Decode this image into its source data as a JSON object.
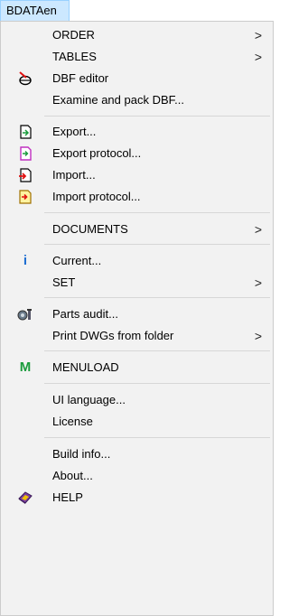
{
  "menubar": {
    "title": "BDATAen"
  },
  "menu": {
    "items": [
      {
        "label": "ORDER",
        "submenu": true,
        "icon": null
      },
      {
        "label": "TABLES",
        "submenu": true,
        "icon": null
      },
      {
        "label": "DBF editor",
        "submenu": false,
        "icon": "dbf-editor-icon"
      },
      {
        "label": "Examine and pack DBF...",
        "submenu": false,
        "icon": null
      },
      {
        "label": "Export...",
        "submenu": false,
        "icon": "export-icon"
      },
      {
        "label": "Export protocol...",
        "submenu": false,
        "icon": "export-protocol-icon"
      },
      {
        "label": "Import...",
        "submenu": false,
        "icon": "import-icon"
      },
      {
        "label": "Import protocol...",
        "submenu": false,
        "icon": "import-protocol-icon"
      },
      {
        "label": "DOCUMENTS",
        "submenu": true,
        "icon": null
      },
      {
        "label": "Current...",
        "submenu": false,
        "icon": "info-icon"
      },
      {
        "label": "SET",
        "submenu": true,
        "icon": null
      },
      {
        "label": "Parts audit...",
        "submenu": false,
        "icon": "parts-audit-icon"
      },
      {
        "label": "Print DWGs from folder",
        "submenu": true,
        "icon": null
      },
      {
        "label": "MENULOAD",
        "submenu": false,
        "icon": "menuload-icon"
      },
      {
        "label": "UI language...",
        "submenu": false,
        "icon": null
      },
      {
        "label": "License",
        "submenu": false,
        "icon": null
      },
      {
        "label": "Build info...",
        "submenu": false,
        "icon": null
      },
      {
        "label": "About...",
        "submenu": false,
        "icon": null
      },
      {
        "label": "HELP",
        "submenu": false,
        "icon": "help-icon"
      }
    ],
    "submenu_arrow": ">",
    "info_glyph": "i",
    "menuload_glyph": "M"
  },
  "colors": {
    "menu_background": "#f2f2f2",
    "menubar_highlight": "#cce8ff",
    "separator": "#d7d7d7",
    "menuload_green": "#1a9b3c",
    "info_blue": "#1f6fd1"
  }
}
